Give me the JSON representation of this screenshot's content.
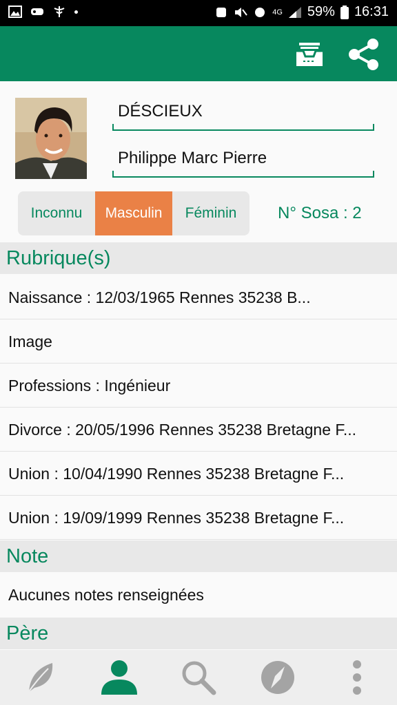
{
  "status_bar": {
    "battery_percent": "59%",
    "time": "16:31",
    "network": "4G"
  },
  "app_bar": {
    "icons": [
      "archive-tray-icon",
      "share-icon"
    ]
  },
  "person": {
    "surname": "DÉSCIEUX",
    "given_names": "Philippe Marc Pierre",
    "sex_options": [
      "Inconnu",
      "Masculin",
      "Féminin"
    ],
    "selected_sex": "Masculin",
    "sosa": "N° Sosa : 2"
  },
  "rubriques": {
    "header": "Rubrique(s)",
    "items": [
      "Naissance : 12/03/1965 Rennes 35238 B...",
      "Image",
      "Professions : Ingénieur",
      "Divorce : 20/05/1996 Rennes 35238 Bretagne F...",
      "Union : 10/04/1990 Rennes 35238 Bretagne F...",
      "Union : 19/09/1999 Rennes 35238 Bretagne F..."
    ]
  },
  "note": {
    "header": "Note",
    "text": "Aucunes notes renseignées"
  },
  "pere": {
    "header": "Père"
  },
  "bottom_nav": {
    "items": [
      "leaf-icon",
      "person-icon",
      "search-icon",
      "compass-icon",
      "more-vert-icon"
    ],
    "active": "person-icon"
  },
  "colors": {
    "primary": "#07885e",
    "accent": "#ea8146",
    "section_bg": "#e8e8e8"
  }
}
